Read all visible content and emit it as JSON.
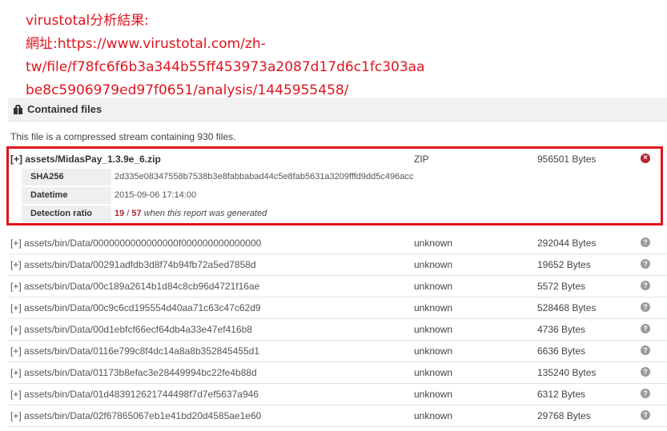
{
  "annotation": {
    "lines": [
      "virustotal分析結果:",
      "網址:https://www.virustotal.com/zh-",
      "tw/file/f78fc6f6b3a344b55ff453973a2087d17d6c1fc303aa",
      "be8c5906979ed97f0651/analysis/1445955458/"
    ],
    "color": "#e0141e"
  },
  "section": {
    "icon": "gift-icon",
    "title": "Contained files"
  },
  "summary": "This file is a compressed stream containing 930 files.",
  "highlighted_file": {
    "toggle": "[+]",
    "name": "assets/MidasPay_1.3.9e_6.zip",
    "type": "ZIP",
    "size": "956501 Bytes",
    "status_icon": "close-circle-icon",
    "details": {
      "sha256_label": "SHA256",
      "sha256": "2d335e08347558b7538b3e8fabbabad44c5e8fab5631a3209fffd9dd5c496acc",
      "datetime_label": "Datetime",
      "datetime": "2015-09-06 17:14:00",
      "ratio_label": "Detection ratio",
      "ratio_positives": "19",
      "ratio_separator": " / ",
      "ratio_total": "57",
      "ratio_suffix": " when this report was generated"
    }
  },
  "files": [
    {
      "toggle": "[+]",
      "name": "assets/bin/Data/0000000000000000f000000000000000",
      "type": "unknown",
      "size": "292044 Bytes",
      "status_icon": "question-icon"
    },
    {
      "toggle": "[+]",
      "name": "assets/bin/Data/00291adfdb3d8f74b94fb72a5ed7858d",
      "type": "unknown",
      "size": "19652 Bytes",
      "status_icon": "question-icon"
    },
    {
      "toggle": "[+]",
      "name": "assets/bin/Data/00c189a2614b1d84c8cb96d4721f16ae",
      "type": "unknown",
      "size": "5572 Bytes",
      "status_icon": "question-icon"
    },
    {
      "toggle": "[+]",
      "name": "assets/bin/Data/00c9c6cd195554d40aa71c63c47c62d9",
      "type": "unknown",
      "size": "528468 Bytes",
      "status_icon": "question-icon"
    },
    {
      "toggle": "[+]",
      "name": "assets/bin/Data/00d1ebfcf66ecf64db4a33e47ef416b8",
      "type": "unknown",
      "size": "4736 Bytes",
      "status_icon": "question-icon"
    },
    {
      "toggle": "[+]",
      "name": "assets/bin/Data/0116e799c8f4dc14a8a8b352845455d1",
      "type": "unknown",
      "size": "6636 Bytes",
      "status_icon": "question-icon"
    },
    {
      "toggle": "[+]",
      "name": "assets/bin/Data/01173b8efac3e28449994bc22fe4b88d",
      "type": "unknown",
      "size": "135240 Bytes",
      "status_icon": "question-icon"
    },
    {
      "toggle": "[+]",
      "name": "assets/bin/Data/01d483912621744498f7d7ef5637a946",
      "type": "unknown",
      "size": "6312 Bytes",
      "status_icon": "question-icon"
    },
    {
      "toggle": "[+]",
      "name": "assets/bin/Data/02f67865067eb1e41bd20d4585ae1e60",
      "type": "unknown",
      "size": "29768 Bytes",
      "status_icon": "question-icon"
    }
  ]
}
